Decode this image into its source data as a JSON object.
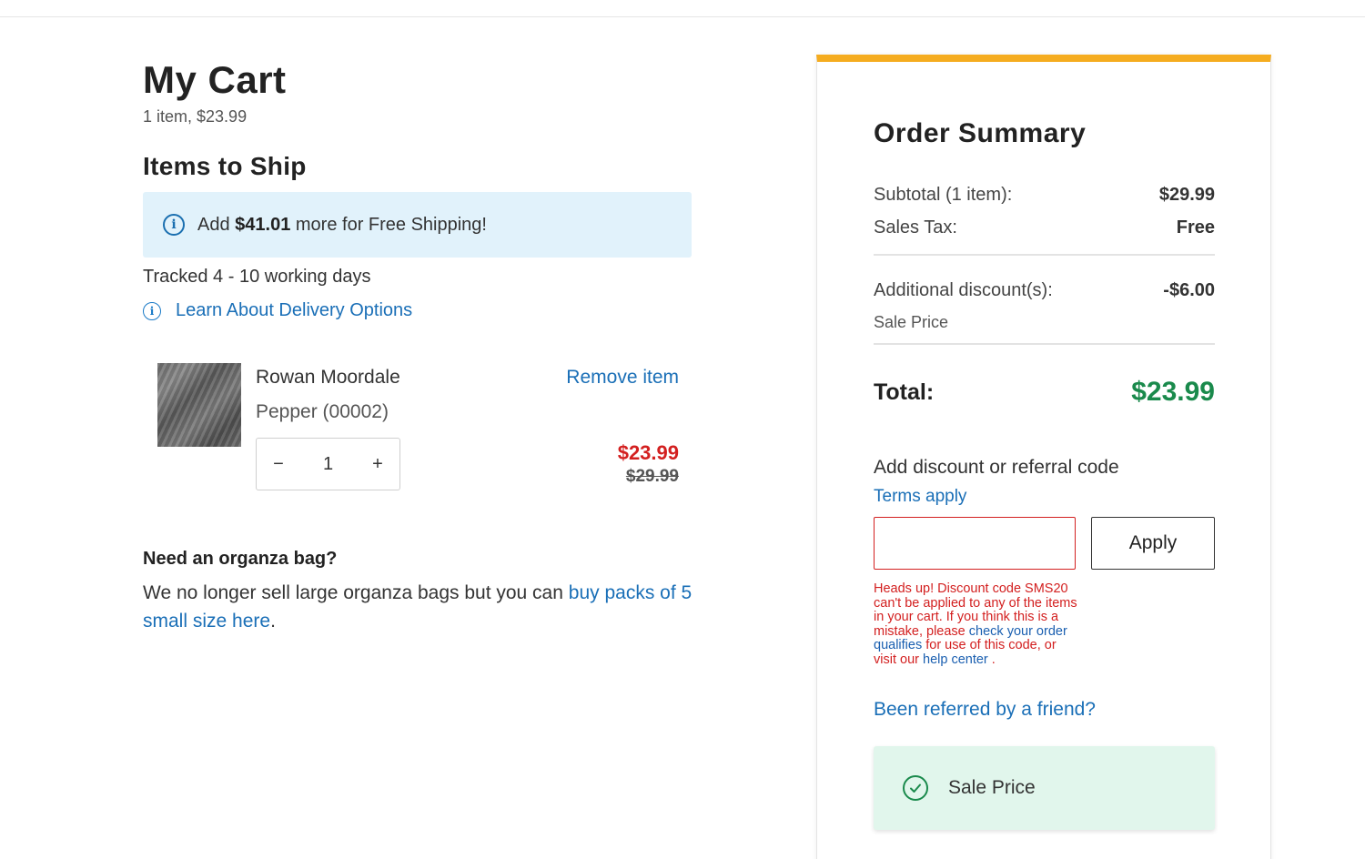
{
  "cart": {
    "title": "My Cart",
    "meta": "1 item, $23.99",
    "section_title": "Items to Ship",
    "shipping_banner": {
      "prefix": "Add",
      "amount": "$41.01",
      "suffix": "more for Free Shipping!"
    },
    "tracked": "Tracked 4 - 10 working days",
    "learn_link": "Learn About Delivery Options",
    "items": [
      {
        "name": "Rowan Moordale",
        "variant": "Pepper (00002)",
        "remove_label": "Remove item",
        "quantity": "1",
        "qty_minus": "−",
        "qty_plus": "+",
        "sale_price": "$23.99",
        "original_price": "$29.99"
      }
    ],
    "organza": {
      "title": "Need an organza bag?",
      "text": "We no longer sell large organza bags but you can",
      "link": "buy packs of 5 small size here",
      "end": "."
    }
  },
  "summary": {
    "title": "Order Summary",
    "subtotal_label": "Subtotal (1 item):",
    "subtotal_value": "$29.99",
    "tax_label": "Sales Tax:",
    "tax_value": "Free",
    "discount_label": "Additional discount(s):",
    "discount_value": "-$6.00",
    "discount_sub": "Sale Price",
    "total_label": "Total:",
    "total_value": "$23.99",
    "code_label": "Add discount or referral code",
    "terms_link": "Terms apply",
    "code_input_value": "",
    "apply_label": "Apply",
    "error": {
      "line1": "Heads up! Discount code SMS20 can't be applied to any of the items in your cart. If you think this is a mistake, please",
      "link1": "check your order qualifies",
      "line2": "for use of this code, or visit our",
      "link2": "help center",
      "end": "."
    },
    "referred_link": "Been referred by a friend?",
    "applied_promo": "Sale Price"
  },
  "colors": {
    "accent_bar": "#f5ac1f",
    "link": "#1a6fb7",
    "sale_red": "#d32020",
    "total_green": "#1a8a4c",
    "banner_bg": "#e1f2fb",
    "promo_bg": "#e1f6ec"
  },
  "icons": {
    "info": "info-icon",
    "check": "check-circle-icon"
  }
}
